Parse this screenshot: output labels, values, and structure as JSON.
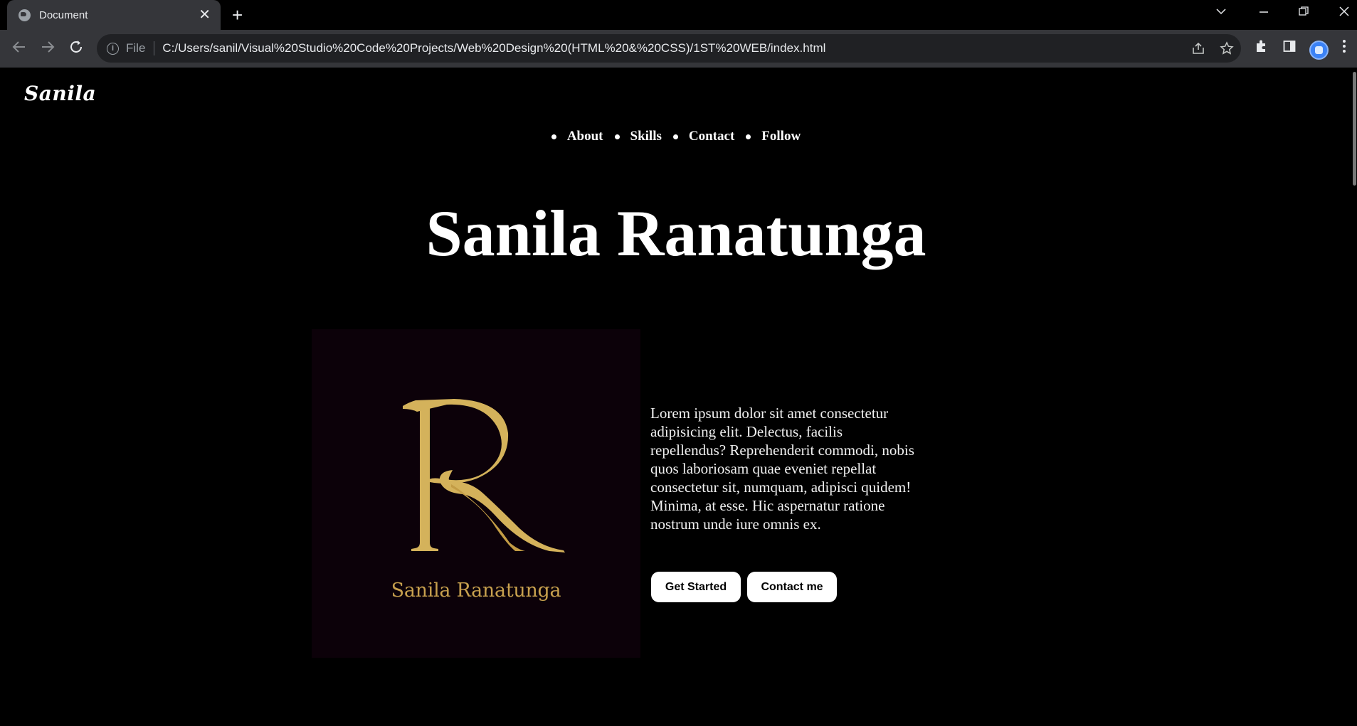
{
  "browser": {
    "tab_title": "Document",
    "tab_close": "✕",
    "new_tab": "+",
    "file_label": "File",
    "url": "C:/Users/sanil/Visual%20Studio%20Code%20Projects/Web%20Design%20(HTML%20&%20CSS)/1ST%20WEB/index.html",
    "icons": [
      "globe-icon",
      "close-icon",
      "plus-icon",
      "chevron-down-icon",
      "minimize-icon",
      "restore-icon",
      "close-window-icon",
      "back-icon",
      "forward-icon",
      "reload-icon",
      "info-icon",
      "share-icon",
      "star-icon",
      "extensions-icon",
      "side-panel-icon",
      "profile-icon",
      "kebab-menu-icon"
    ]
  },
  "site": {
    "logo": "Sanila",
    "nav": [
      {
        "label": "About"
      },
      {
        "label": "Skills"
      },
      {
        "label": "Contact"
      },
      {
        "label": "Follow"
      }
    ],
    "hero_title": "Sanila Ranatunga",
    "image": {
      "monogram": "R",
      "caption": "Sanila Ranatunga",
      "gold_color": "#d4b25b",
      "background": "#0c0109"
    },
    "intro": "Lorem ipsum dolor sit amet consectetur adipisicing elit. Delectus, facilis repellendus? Reprehenderit commodi, nobis quos laboriosam quae eveniet repellat consectetur sit, numquam, adipisci quidem! Minima, at esse. Hic aspernatur ratione nostrum unde iure omnis ex.",
    "buttons": {
      "get_started": "Get Started",
      "contact_me": "Contact me"
    }
  }
}
